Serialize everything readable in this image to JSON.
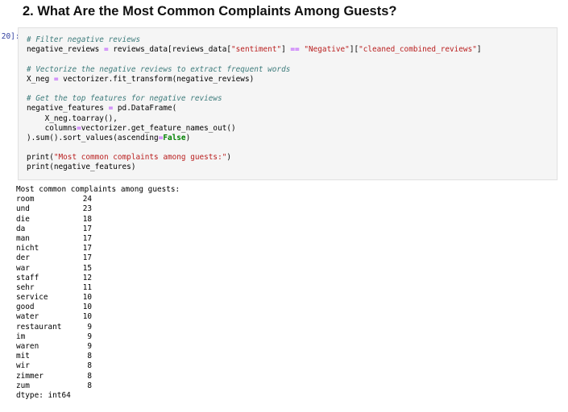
{
  "heading": "2. What Are the Most Common Complaints Among Guests?",
  "cell": {
    "prompt": "[20]:",
    "code": {
      "l1_comment": "# Filter negative reviews",
      "l2_a": "negative_reviews ",
      "l2_eq": "=",
      "l2_b": " reviews_data[reviews_data[",
      "l2_s1": "\"sentiment\"",
      "l2_c": "] ",
      "l2_eqeq": "==",
      "l2_d": " ",
      "l2_s2": "\"Negative\"",
      "l2_e": "][",
      "l2_s3": "\"cleaned_combined_reviews\"",
      "l2_f": "]",
      "l4_comment": "# Vectorize the negative reviews to extract frequent words",
      "l5_a": "X_neg ",
      "l5_eq": "=",
      "l5_b": " vectorizer.fit_transform(negative_reviews)",
      "l7_comment": "# Get the top features for negative reviews",
      "l8_a": "negative_features ",
      "l8_eq": "=",
      "l8_b": " pd.DataFrame(",
      "l9": "    X_neg.toarray(),",
      "l10_a": "    columns",
      "l10_eq": "=",
      "l10_b": "vectorizer.get_feature_names_out()",
      "l11_a": ").sum().sort_values(ascending",
      "l11_eq": "=",
      "l11_kw": "False",
      "l11_b": ")",
      "l13_a": "print(",
      "l13_s": "\"Most common complaints among guests:\"",
      "l13_b": ")",
      "l14": "print(negative_features)"
    }
  },
  "output": {
    "header": "Most common complaints among guests:",
    "rows": [
      {
        "word": "room",
        "count": "24"
      },
      {
        "word": "und",
        "count": "23"
      },
      {
        "word": "die",
        "count": "18"
      },
      {
        "word": "da",
        "count": "17"
      },
      {
        "word": "man",
        "count": "17"
      },
      {
        "word": "nicht",
        "count": "17"
      },
      {
        "word": "der",
        "count": "17"
      },
      {
        "word": "war",
        "count": "15"
      },
      {
        "word": "staff",
        "count": "12"
      },
      {
        "word": "sehr",
        "count": "11"
      },
      {
        "word": "service",
        "count": "10"
      },
      {
        "word": "good",
        "count": "10"
      },
      {
        "word": "water",
        "count": "10"
      },
      {
        "word": "restaurant",
        "count": "9"
      },
      {
        "word": "im",
        "count": "9"
      },
      {
        "word": "waren",
        "count": "9"
      },
      {
        "word": "mit",
        "count": "8"
      },
      {
        "word": "wir",
        "count": "8"
      },
      {
        "word": "zimmer",
        "count": "8"
      },
      {
        "word": "zum",
        "count": "8"
      }
    ],
    "dtype": "dtype: int64"
  },
  "colors": {
    "comment": "#3d7b7b",
    "string": "#ba2121",
    "operator": "#aa22ff",
    "keyword": "#008000",
    "prompt": "#303f9f",
    "code_background": "#f5f5f5"
  }
}
